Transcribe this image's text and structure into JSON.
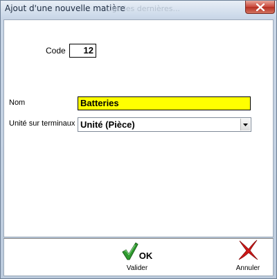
{
  "window": {
    "title": "Ajout d'une nouvelle matière",
    "title_ghost": "...ge les dernières..."
  },
  "form": {
    "code_label": "Code",
    "code_value": "12",
    "nom_label": "Nom",
    "nom_value": "Batteries",
    "unit_label": "Unité sur terminaux",
    "unit_value": "Unité (Pièce)"
  },
  "footer": {
    "ok_text": "OK",
    "valider_label": "Valider",
    "annuler_label": "Annuler"
  },
  "colors": {
    "nom_field_bg": "#ffff00",
    "ok_check": "#2f9a2f",
    "cancel_x": "#d01818"
  },
  "icons": {
    "close": "close-icon",
    "dropdown": "chevron-down-icon",
    "ok": "checkmark-icon",
    "cancel": "red-x-icon"
  }
}
